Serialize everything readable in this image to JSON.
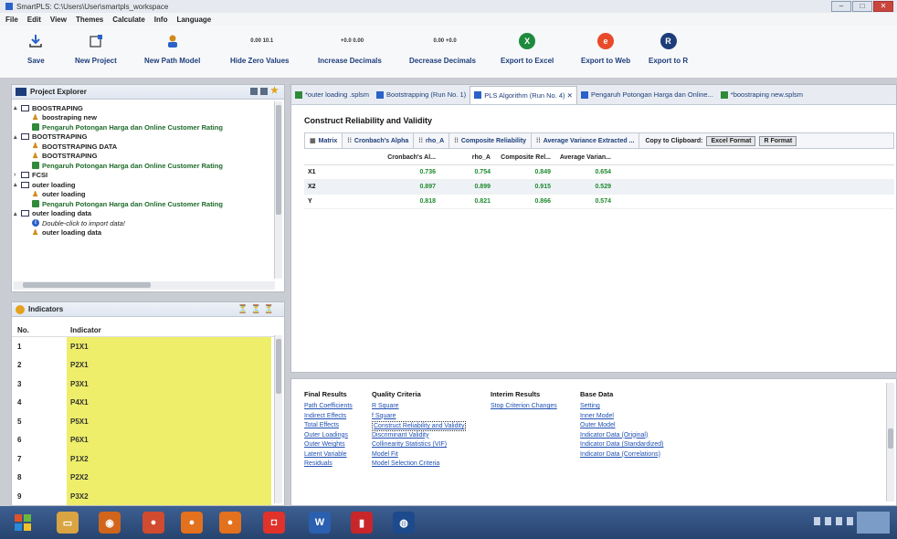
{
  "window": {
    "title": "SmartPLS: C:\\Users\\User\\smartpls_workspace",
    "controls": [
      "–",
      "□",
      "✕"
    ]
  },
  "menu": [
    "File",
    "Edit",
    "View",
    "Themes",
    "Calculate",
    "Info",
    "Language"
  ],
  "toolbar": {
    "save": "Save",
    "new_project": "New Project",
    "new_path_model": "New Path Model",
    "hide_zero_values": "Hide Zero Values",
    "hide_zero_icon": "0.00 10.1",
    "increase_decimals": "Increase Decimals",
    "increase_icon": "+0.0 0.00",
    "decrease_decimals": "Decrease Decimals",
    "decrease_icon": "0.00 +0.0",
    "export_excel": "Export to Excel",
    "export_excel_icon": "X",
    "export_web": "Export to Web",
    "export_web_icon": "e",
    "export_r": "Export to R",
    "export_r_icon": "R"
  },
  "project_explorer": {
    "title": "Project Explorer",
    "items": [
      {
        "indent": 0,
        "twisty": "▴",
        "icon": "folder",
        "label": "BOOSTRAPING"
      },
      {
        "indent": 1,
        "twisty": "",
        "icon": "person",
        "label": "boostraping new"
      },
      {
        "indent": 1,
        "twisty": "",
        "icon": "data",
        "label": "Pengaruh Potongan Harga dan Online Customer Rating"
      },
      {
        "indent": 0,
        "twisty": "▴",
        "icon": "folder",
        "label": "BOOTSTRAPING"
      },
      {
        "indent": 1,
        "twisty": "",
        "icon": "person",
        "label": "BOOTSTRAPING DATA"
      },
      {
        "indent": 1,
        "twisty": "",
        "icon": "person",
        "label": "BOOTSTRAPING"
      },
      {
        "indent": 1,
        "twisty": "",
        "icon": "data",
        "label": "Pengaruh Potongan Harga dan Online Customer Rating"
      },
      {
        "indent": 0,
        "twisty": "›",
        "icon": "folder",
        "label": "FCSI"
      },
      {
        "indent": 0,
        "twisty": "▴",
        "icon": "folder",
        "label": "outer loading"
      },
      {
        "indent": 1,
        "twisty": "",
        "icon": "person",
        "label": "outer loading"
      },
      {
        "indent": 1,
        "twisty": "",
        "icon": "data",
        "label": "Pengaruh Potongan Harga dan Online Customer Rating"
      },
      {
        "indent": 0,
        "twisty": "▴",
        "icon": "folder",
        "label": "outer loading data"
      },
      {
        "indent": 1,
        "twisty": "",
        "icon": "info",
        "label": "Double-click to import data!"
      },
      {
        "indent": 1,
        "twisty": "",
        "icon": "person",
        "label": "outer loading data"
      }
    ]
  },
  "indicators": {
    "title": "Indicators",
    "col_no": "No.",
    "col_indicator": "Indicator",
    "rows": [
      {
        "no": "1",
        "name": "P1X1"
      },
      {
        "no": "2",
        "name": "P2X1"
      },
      {
        "no": "3",
        "name": "P3X1"
      },
      {
        "no": "4",
        "name": "P4X1"
      },
      {
        "no": "5",
        "name": "P5X1"
      },
      {
        "no": "6",
        "name": "P6X1"
      },
      {
        "no": "7",
        "name": "P1X2"
      },
      {
        "no": "8",
        "name": "P2X2"
      },
      {
        "no": "9",
        "name": "P3X2"
      }
    ]
  },
  "editor_tabs": [
    {
      "label": "*outer loading .splsm",
      "active": false,
      "color": "#2f8a3a"
    },
    {
      "label": "Bootstrapping (Run No. 1)",
      "active": false,
      "color": "#2a62c9"
    },
    {
      "label": "PLS Algorithm (Run No. 4) ✕",
      "active": true,
      "color": "#2a62c9"
    },
    {
      "label": "Pengaruh Potongan Harga dan Online...",
      "active": false,
      "color": "#2a62c9"
    },
    {
      "label": "*boostraping new.splsm",
      "active": false,
      "color": "#2f8a3a"
    }
  ],
  "report": {
    "title": "Construct Reliability and Validity",
    "subtabs": [
      {
        "label": "Matrix",
        "icon": "▦",
        "active": true
      },
      {
        "label": "Cronbach's Alpha",
        "icon": "⁞⁞",
        "active": false
      },
      {
        "label": "rho_A",
        "icon": "⁞⁞",
        "active": false
      },
      {
        "label": "Composite Reliability",
        "icon": "⁞⁞",
        "active": false
      },
      {
        "label": "Average Variance Extracted ...",
        "icon": "⁞⁞",
        "active": false
      }
    ],
    "copy_clipboard": "Copy to Clipboard:",
    "excel_format": "Excel Format",
    "r_format": "R Format",
    "columns": [
      "Cronbach's Al...",
      "rho_A",
      "Composite Rel...",
      "Average Varian..."
    ],
    "rows": [
      {
        "name": "X1",
        "values": [
          "0.736",
          "0.754",
          "0.849",
          "0.654"
        ]
      },
      {
        "name": "X2",
        "values": [
          "0.897",
          "0.899",
          "0.915",
          "0.529"
        ]
      },
      {
        "name": "Y",
        "values": [
          "0.818",
          "0.821",
          "0.866",
          "0.574"
        ]
      }
    ]
  },
  "results": {
    "final_results": {
      "title": "Final Results",
      "links": [
        "Path Coefficients",
        "Indirect Effects",
        "Total Effects",
        "Outer Loadings",
        "Outer Weights",
        "Latent Variable",
        "Residuals"
      ]
    },
    "quality_criteria": {
      "title": "Quality Criteria",
      "links": [
        "R Square",
        "f Square",
        "Construct Reliability and Validity",
        "Discriminant Validity",
        "Collinearity Statistics (VIF)",
        "Model Fit",
        "Model Selection Criteria"
      ]
    },
    "interim_results": {
      "title": "Interim Results",
      "links": [
        "Stop Criterion Changes"
      ]
    },
    "base_data": {
      "title": "Base Data",
      "links": [
        "Setting",
        "Inner Model",
        "Outer Model",
        "Indicator Data (Original)",
        "Indicator Data (Standardized)",
        "Indicator Data (Correlations)"
      ]
    }
  },
  "taskbar": {
    "start_icon": "windows-start-icon",
    "apps": [
      {
        "name": "file-explorer-icon",
        "color": "#d9a441",
        "glyph": "▭"
      },
      {
        "name": "media-player-icon",
        "color": "#d0651b",
        "glyph": "◉"
      },
      {
        "name": "chrome-icon",
        "color": "#d14b30",
        "glyph": "●"
      },
      {
        "name": "firefox-icon",
        "color": "#e3711e",
        "glyph": "●"
      },
      {
        "name": "firefox-alt-icon",
        "color": "#e3711e",
        "glyph": "●"
      },
      {
        "name": "app-red-icon",
        "color": "#e0322a",
        "glyph": "◘"
      },
      {
        "name": "word-icon",
        "color": "#2b5fb0",
        "glyph": "W"
      },
      {
        "name": "pdf-icon",
        "color": "#c8262a",
        "glyph": "▮"
      },
      {
        "name": "smartpls-icon",
        "color": "#1d4a8c",
        "glyph": "◍"
      }
    ]
  }
}
